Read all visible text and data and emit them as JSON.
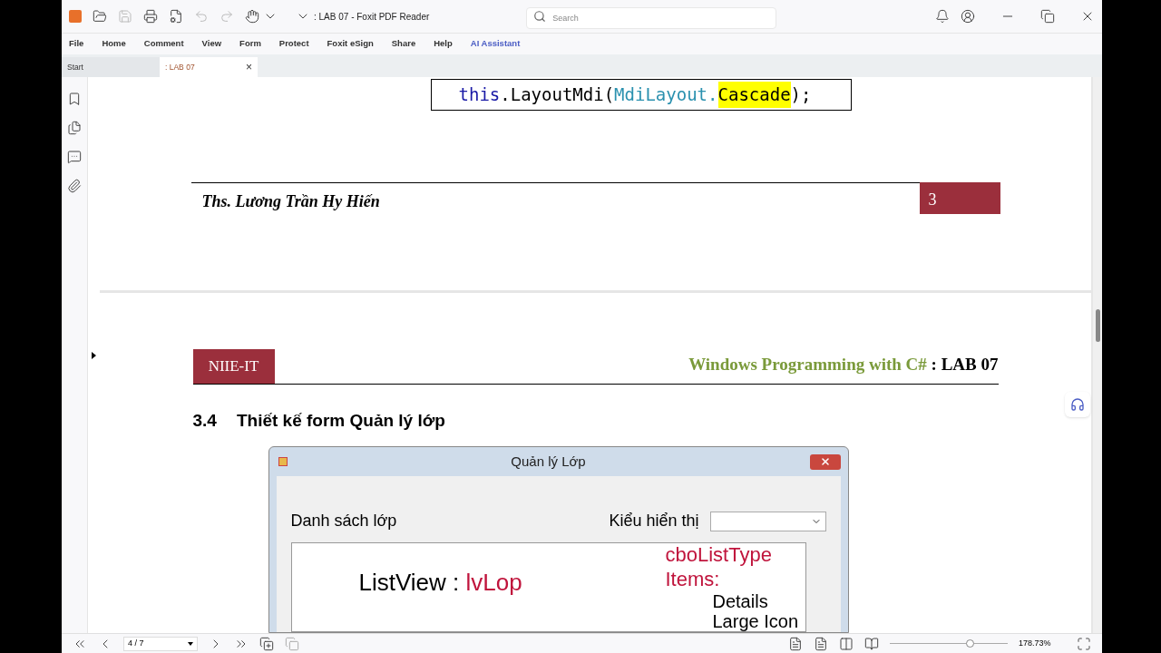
{
  "window": {
    "title": ": LAB 07 - Foxit PDF Reader",
    "search_placeholder": "Search"
  },
  "menu": [
    {
      "label": "File",
      "kind": "plain"
    },
    {
      "label": "Home",
      "kind": "plain"
    },
    {
      "label": "Comment",
      "kind": "plain"
    },
    {
      "label": "View",
      "kind": "plain"
    },
    {
      "label": "Form",
      "kind": "plain"
    },
    {
      "label": "Protect",
      "kind": "plain"
    },
    {
      "label": "Foxit eSign",
      "kind": "plain"
    },
    {
      "label": "Share",
      "kind": "plain"
    },
    {
      "label": "Help",
      "kind": "plain"
    },
    {
      "label": "AI Assistant",
      "kind": "ai"
    }
  ],
  "tabs": [
    {
      "label": "Start",
      "selected": false,
      "closable": false
    },
    {
      "label": ": LAB 07",
      "selected": true,
      "closable": true
    }
  ],
  "close_glyph": "×",
  "page_top": {
    "code": [
      {
        "text": "this",
        "kind": "keyword"
      },
      {
        "text": ".LayoutMdi(",
        "kind": "plain"
      },
      {
        "text": "MdiLayout.",
        "kind": "type"
      },
      {
        "text": "Cascade",
        "kind": "highlight"
      },
      {
        "text": ");",
        "kind": "plain"
      }
    ],
    "author": "Ths. Lương Trần Hy Hiến",
    "page_number": "3"
  },
  "page_next": {
    "org": "NIIE-IT",
    "course": "Windows Programming with C#",
    "lab": " : LAB 07",
    "section_number": "3.4",
    "section_title": "Thiết kế form Quản lý lớp",
    "form": {
      "title": "Quản lý Lớp",
      "list_label": "Danh sách lớp",
      "type_label": "Kiểu hiển thị",
      "listview_label": "ListView : ",
      "listview_name": "lvLop",
      "combo_name": "cboListType",
      "items_label": "Items:",
      "items": [
        "Details",
        "Large Icon"
      ]
    }
  },
  "status_bar": {
    "page": "4 / 7",
    "zoom": "178.73%",
    "level": 0.68
  }
}
